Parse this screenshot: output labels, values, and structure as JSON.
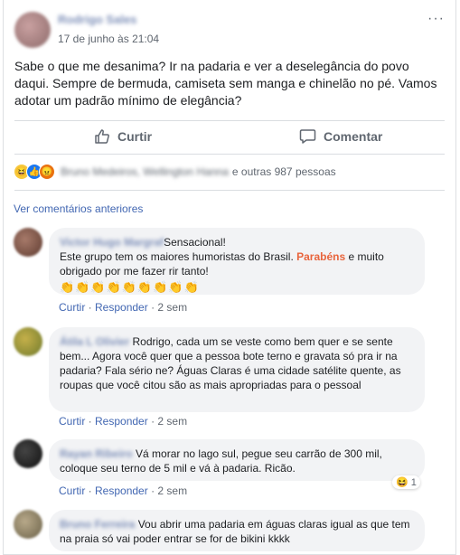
{
  "post": {
    "author": "Rodrigo Sales",
    "date": "17 de junho às 21:04",
    "text": "Sabe o que me desanima? Ir na padaria e ver a deselegância do povo daqui. Sempre de bermuda, camiseta sem manga e chinelão no pé. Vamos adotar um padrão mínimo de elegância?",
    "menu_glyph": "···"
  },
  "actions": {
    "like_label": "Curtir",
    "comment_label": "Comentar"
  },
  "reactions": {
    "names": "Bruno Medeiros, Wellington Hanna",
    "others": "e outras 987 pessoas",
    "icons": [
      "haha-icon",
      "like-icon",
      "angry-icon"
    ]
  },
  "previous_comments_label": "Ver comentários anteriores",
  "comments": [
    {
      "name": "Victor Hugo Margraf",
      "text_a": "Sensacional!",
      "text_b": "Este grupo tem os maiores humoristas do Brasil. ",
      "highlight": "Parabéns",
      "text_c": " e muito obrigado por me fazer rir tanto!",
      "claps": "👏👏👏👏👏👏👏👏👏",
      "like": "Curtir",
      "reply": "Responder",
      "time": "2 sem"
    },
    {
      "name": "Átila L Olivier",
      "text": "Rodrigo, cada um se veste como bem quer e se sente bem... Agora você quer que a pessoa bote terno e gravata só pra ir na padaria? Fala sério ne? Águas Claras é uma cidade satélite quente, as roupas que você citou são as mais apropriadas para o pessoal",
      "like": "Curtir",
      "reply": "Responder",
      "time": "2 sem"
    },
    {
      "name": "Rayan Ribeiro",
      "text": "Vá morar no lago sul, pegue seu carrão de 300 mil, coloque seu terno de 5 mil e vá à padaria. Ricão.",
      "reaction_count": "1",
      "like": "Curtir",
      "reply": "Responder",
      "time": "2 sem"
    },
    {
      "name": "Bruno Ferreira",
      "text": "Vou abrir uma padaria em águas claras igual as que tem na praia só vai poder entrar se for de bikini kkkk"
    }
  ],
  "colors": {
    "link": "#4267b2",
    "bubble": "#f2f3f5",
    "highlight": "#e8643c",
    "meta": "#606770"
  }
}
